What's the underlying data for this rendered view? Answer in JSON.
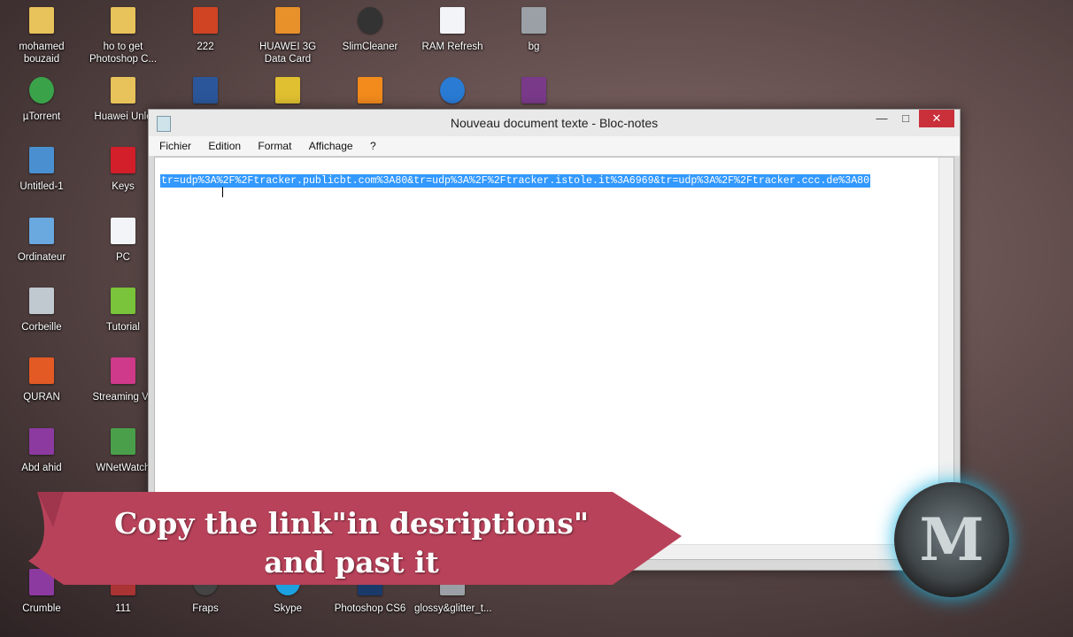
{
  "desktop": {
    "icons": [
      {
        "label": "mohamed bouzaid",
        "icon": "folder-user-icon"
      },
      {
        "label": "ho to get Photoshop C...",
        "icon": "folder-icon"
      },
      {
        "label": "222",
        "icon": "powerpoint-file-icon"
      },
      {
        "label": "HUAWEI 3G Data Card",
        "icon": "huawei-3g-icon"
      },
      {
        "label": "SlimCleaner",
        "icon": "slimcleaner-icon"
      },
      {
        "label": "RAM Refresh",
        "icon": "document-icon"
      },
      {
        "label": "bg",
        "icon": "image-file-icon"
      },
      {
        "label": "µTorrent",
        "icon": "utorrent-icon"
      },
      {
        "label": "Huawei Unlo",
        "icon": "folder-icon"
      },
      {
        "label": "",
        "icon": "word-file-icon"
      },
      {
        "label": "",
        "icon": "certificate-icon"
      },
      {
        "label": "",
        "icon": "vlc-icon"
      },
      {
        "label": "",
        "icon": "media-player-icon"
      },
      {
        "label": "",
        "icon": "winrar-icon"
      },
      {
        "label": "Untitled-1",
        "icon": "photoshop-file-icon"
      },
      {
        "label": "Keys",
        "icon": "red-folder-icon"
      },
      {
        "label": "Ordinateur",
        "icon": "computer-icon"
      },
      {
        "label": "PC",
        "icon": "document-icon"
      },
      {
        "label": "Corbeille",
        "icon": "recycle-bin-icon"
      },
      {
        "label": "Tutorial",
        "icon": "green-folder-icon"
      },
      {
        "label": "QURAN",
        "icon": "orange-folder-icon"
      },
      {
        "label": "Streaming Ve",
        "icon": "streaming-video-icon"
      },
      {
        "label": "Abd  ahid",
        "icon": "purple-folder-icon"
      },
      {
        "label": "WNetWatch",
        "icon": "network-watch-icon"
      },
      {
        "label": "Crumble",
        "icon": "purple-folder-icon"
      },
      {
        "label": "111",
        "icon": "app-icon"
      },
      {
        "label": "Fraps",
        "icon": "fraps-icon"
      },
      {
        "label": "Skype",
        "icon": "skype-icon"
      },
      {
        "label": "Photoshop CS6",
        "icon": "photoshop-icon"
      },
      {
        "label": "glossy&glitter_t...",
        "icon": "image-file-icon"
      }
    ]
  },
  "notepad": {
    "title": "Nouveau document texte - Bloc-notes",
    "controls": {
      "minimize": "—",
      "maximize": "□",
      "close": "✕"
    },
    "menu": [
      "Fichier",
      "Edition",
      "Format",
      "Affichage",
      "?"
    ],
    "content": "tr=udp%3A%2F%2Ftracker.publicbt.com%3A80&tr=udp%3A%2F%2Ftracker.istole.it%3A6969&tr=udp%3A%2F%2Ftracker.ccc.de%3A80"
  },
  "banner": {
    "line1": "Copy the link\"in desriptions\"",
    "line2": "and past it"
  },
  "logo": {
    "letter": "M"
  },
  "colors": {
    "banner": "#b8425a",
    "selection": "#3399ff",
    "close": "#c9303a",
    "glow": "#21b6e0"
  }
}
